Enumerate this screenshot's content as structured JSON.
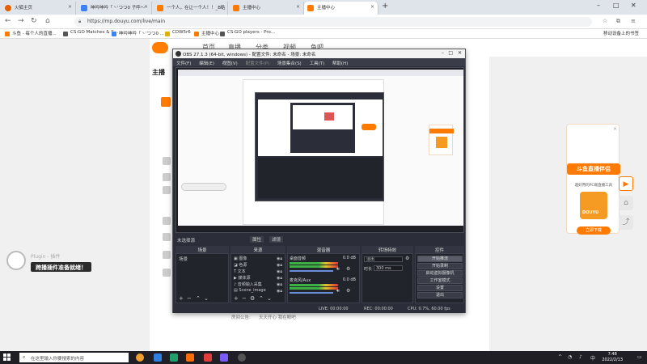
{
  "browser": {
    "tabs": [
      {
        "label": "火狐主页",
        "fav_color": "#e66000"
      },
      {
        "label": "呻吟呻吟「丶'つつ0 子呼～",
        "fav_color": "#3b82f6"
      },
      {
        "label": "一个人，在让一个人！！_B站",
        "fav_color": "#ff7a00"
      },
      {
        "label": "主播中心",
        "fav_color": "#ff7a00"
      },
      {
        "label": "主播中心",
        "fav_color": "#ff7a00"
      }
    ],
    "new_tab": "+",
    "url": "https://mp.douyu.com/live/main",
    "bookmarks": [
      {
        "label": "斗鱼 - 每个人的直播...",
        "color": "#ff7a00"
      },
      {
        "label": "CS:GO Matches & S...",
        "color": "#555555"
      },
      {
        "label": "呻吟呻吟「丶'つつ0 ...",
        "color": "#3b82f6"
      },
      {
        "label": "CDW5r6",
        "color": "#e0b000"
      },
      {
        "label": "主播中心",
        "color": "#ff7a00"
      },
      {
        "label": "CS:GO players - Pro...",
        "color": "#555555"
      }
    ],
    "mobile_bookmarks": "移动设备上的书签"
  },
  "douyu": {
    "nav": [
      "首页",
      "直播",
      "分类",
      "视频",
      "鱼吧"
    ],
    "sidebar_title": "主播",
    "promo": {
      "title": "斗鱼直播伴侣",
      "subtitle": "超好用的PC端直播工具",
      "image_text": "DOUYU",
      "button": "立即下载"
    },
    "plugin_label": "跨播插件准备就绪！",
    "plugin_faint": "Plugin - 插件",
    "room_notice_label": "房间公告:",
    "room_notice": "天天开心 我在鲸吧"
  },
  "obs": {
    "title": "OBS 27.1.3 (64-bit, windows) - 配置文件: 未命名 - 场景: 未命名",
    "menu": [
      "文件(F)",
      "编辑(E)",
      "视图(V)",
      "配置文件(P)",
      "场景集合(S)",
      "工具(T)",
      "帮助(H)"
    ],
    "no_source": "未选择源",
    "prop_btn": "属性",
    "filter_btn": "滤镜",
    "docks": [
      "场景",
      "来源",
      "混音器",
      "转场特效",
      "控件"
    ],
    "scenes": [
      "场景"
    ],
    "sources": [
      {
        "label": "图像"
      },
      {
        "label": "色源"
      },
      {
        "label": "文本"
      },
      {
        "label": "媒体源"
      },
      {
        "label": "音频输入采集"
      },
      {
        "label": "Scene_image"
      }
    ],
    "mixer": [
      {
        "name": "桌面音频",
        "db": "0.0 dB"
      },
      {
        "name": "麦克风/Aux",
        "db": "0.0 dB"
      }
    ],
    "transition": {
      "type": "淡出",
      "duration_label": "时长",
      "duration": "300 ms"
    },
    "controls": [
      "开始推流",
      "开始录制",
      "启动虚拟摄像机",
      "工作室模式",
      "设置",
      "退出"
    ],
    "status": {
      "live": "LIVE: 00:00:00",
      "rec": "REC: 00:00:00",
      "cpu": "CPU: 0.7%, 60.00 fps"
    }
  },
  "taskbar": {
    "search_placeholder": "在这里输入你要搜索的内容",
    "time": "7:48",
    "date": "2022/2/13",
    "app_colors": [
      "#f0a030",
      "#2f7fe0",
      "#22a06b",
      "#ff6d00",
      "#e23c3c",
      "#7a5af8",
      "#aaaaaa",
      "#555555"
    ]
  }
}
